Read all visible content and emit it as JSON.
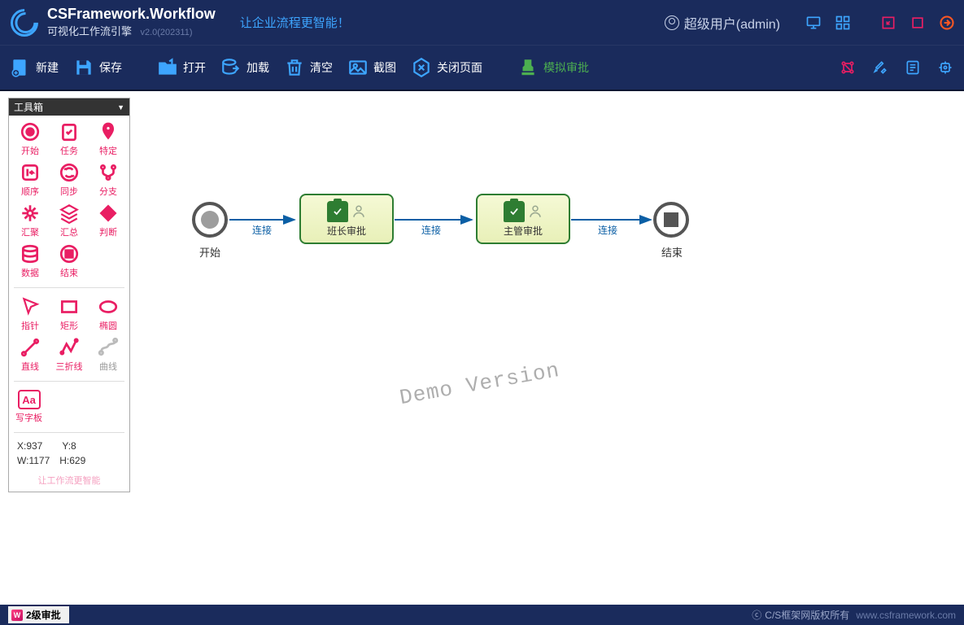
{
  "header": {
    "title": "CSFramework.Workflow",
    "subtitle": "可视化工作流引擎",
    "version": "v2.0(202311)",
    "slogan": "让企业流程更智能！",
    "user": "超级用户(admin)"
  },
  "toolbar": {
    "new": "新建",
    "save": "保存",
    "open": "打开",
    "load": "加载",
    "clear": "清空",
    "screenshot": "截图",
    "closepage": "关闭页面",
    "simulate": "模拟审批"
  },
  "toolbox": {
    "title": "工具箱",
    "nodes": [
      "开始",
      "任务",
      "特定",
      "顺序",
      "同步",
      "分支",
      "汇聚",
      "汇总",
      "判断",
      "数据",
      "结束"
    ],
    "shapes": [
      "指针",
      "矩形",
      "椭圆",
      "直线",
      "三折线",
      "曲线"
    ],
    "text": "写字板",
    "coords": {
      "x": "X:937",
      "y": "Y:8",
      "w": "W:1177",
      "h": "H:629"
    },
    "footer": "让工作流更智能"
  },
  "workflow": {
    "start": "开始",
    "task1": "班长审批",
    "task2": "主管审批",
    "end": "结束",
    "link": "连接"
  },
  "watermark": "Demo Version",
  "footer": {
    "tab": "2级审批",
    "copyright": "C/S框架网版权所有",
    "url": "www.csframework.com"
  }
}
